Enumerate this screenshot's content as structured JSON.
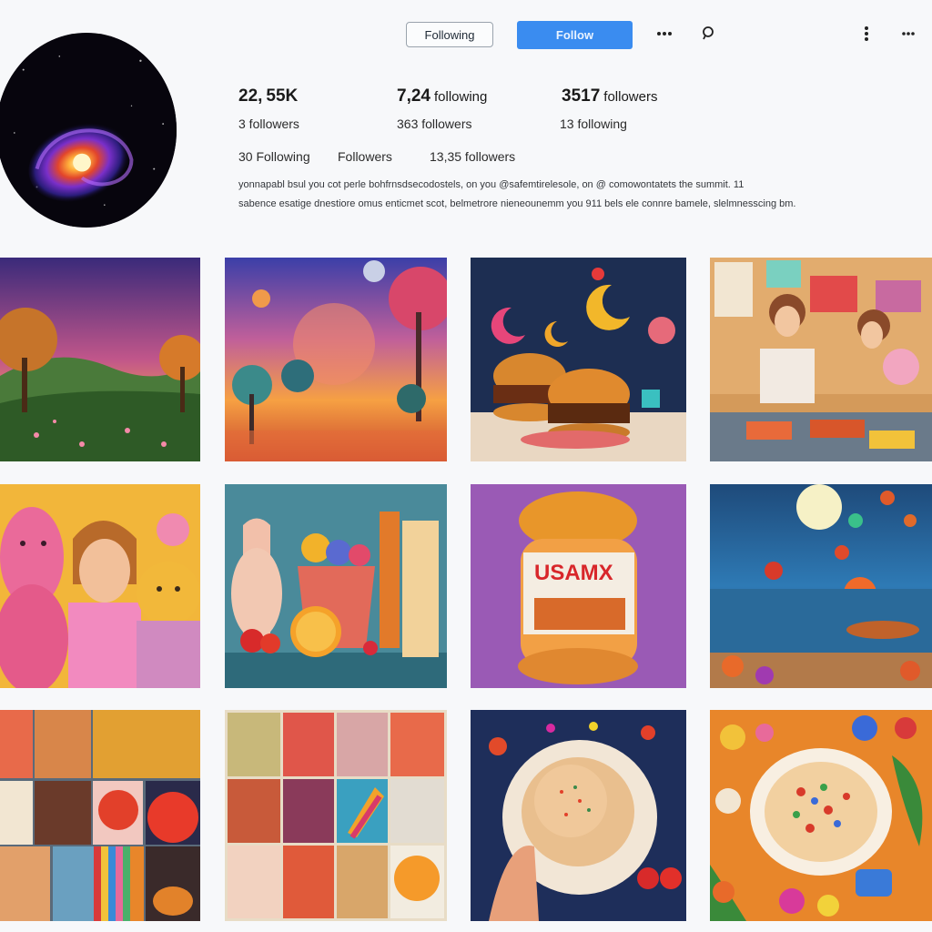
{
  "header": {
    "following_button": "Following",
    "follow_button": "Follow",
    "more_icon": "more-horizontal-icon",
    "search_icon": "search-icon",
    "kebab_icon": "more-vertical-icon",
    "overflow_icon": "more-horizontal-icon"
  },
  "stats": {
    "row1": [
      {
        "value": "22,",
        "label": "55K"
      },
      {
        "value": "7,24",
        "label": "following"
      },
      {
        "value": "3517",
        "label": "followers"
      }
    ],
    "row2": [
      "3 followers",
      "363 followers",
      "13 following"
    ],
    "row3": [
      "30 Following",
      "Followers",
      "13,35 followers"
    ]
  },
  "bio": {
    "line1": "yonnapabl bsul you cot perle bohfrnsdsecodostels, on you @safemtirelesole, on @ comowontatets the summit. 11",
    "line2": "sabence esatige dnestiore omus enticmet scot, belmetrore nieneounemm you 911 bels ele connre bamele, slelmnesscing bm."
  },
  "colors": {
    "accent": "#3a8cf0",
    "background": "#f7f8fa"
  },
  "grid": [
    {
      "name": "post-sunset-meadow"
    },
    {
      "name": "post-fantasy-sunset"
    },
    {
      "name": "post-burgers-moons"
    },
    {
      "name": "post-women-dinner"
    },
    {
      "name": "post-pink-figures"
    },
    {
      "name": "post-still-life"
    },
    {
      "name": "post-spread-jar"
    },
    {
      "name": "post-ocean-sun"
    },
    {
      "name": "post-art-collage"
    },
    {
      "name": "post-poster-grid"
    },
    {
      "name": "post-latte-cup"
    },
    {
      "name": "post-colorful-pie"
    }
  ]
}
